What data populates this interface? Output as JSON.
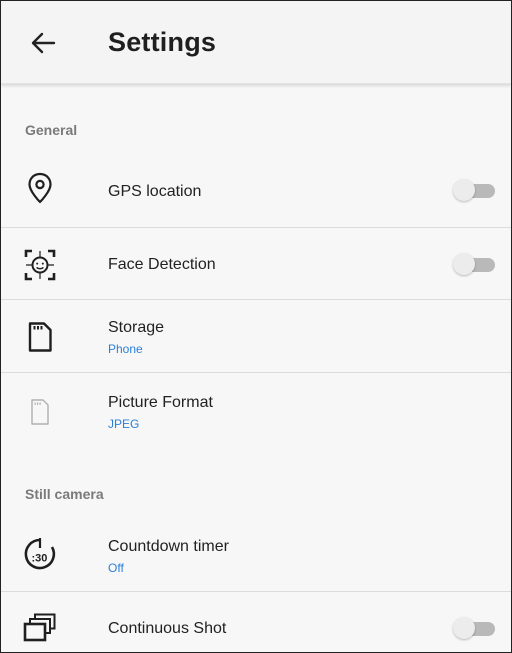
{
  "appbar": {
    "title": "Settings",
    "back_icon": "arrow-left-icon"
  },
  "sections": {
    "general": {
      "header": "General",
      "items": [
        {
          "label": "GPS location",
          "icon": "location-pin-icon",
          "toggle": false
        },
        {
          "label": "Face Detection",
          "icon": "face-detection-icon",
          "toggle": false
        },
        {
          "label": "Storage",
          "value": "Phone",
          "icon": "sd-card-icon"
        },
        {
          "label": "Picture Format",
          "value": "JPEG",
          "icon": "picture-format-icon"
        }
      ]
    },
    "still_camera": {
      "header": "Still camera",
      "items": [
        {
          "label": "Countdown timer",
          "value": "Off",
          "icon": "countdown-timer-icon"
        },
        {
          "label": "Continuous Shot",
          "icon": "continuous-shot-icon",
          "toggle": false
        }
      ]
    }
  },
  "colors": {
    "accent": "#2b7fd8",
    "toggle_off_track": "#b9b9b9",
    "toggle_off_thumb": "#ececec"
  }
}
